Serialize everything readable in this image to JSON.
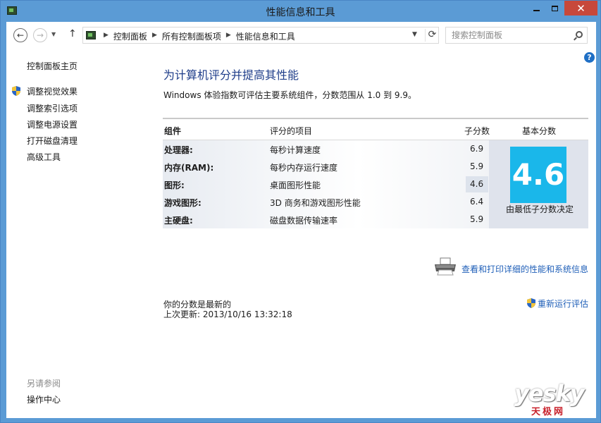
{
  "window": {
    "title": "性能信息和工具",
    "minimize_glyph": "—",
    "close_glyph": "✕"
  },
  "navbar": {
    "back_glyph": "←",
    "forward_glyph": "→",
    "up_glyph": "↑",
    "breadcrumbs": [
      "控制面板",
      "所有控制面板项",
      "性能信息和工具"
    ],
    "breadcrumb_separator": "▶",
    "search_placeholder": "搜索控制面板"
  },
  "sidebar": {
    "home": "控制面板主页",
    "links": [
      "调整视觉效果",
      "调整索引选项",
      "调整电源设置",
      "打开磁盘清理",
      "高级工具"
    ],
    "see_also_heading": "另请参阅",
    "see_also_links": [
      "操作中心"
    ]
  },
  "main": {
    "title": "为计算机评分并提高其性能",
    "subtitle": "Windows 体验指数可评估主要系统组件，分数范围从 1.0 到 9.9。",
    "table": {
      "headers": {
        "component": "组件",
        "item": "评分的项目",
        "subscore": "子分数",
        "basescore": "基本分数"
      },
      "rows": [
        {
          "component": "处理器:",
          "item": "每秒计算速度",
          "score": "6.9"
        },
        {
          "component": "内存(RAM):",
          "item": "每秒内存运行速度",
          "score": "5.9"
        },
        {
          "component": "图形:",
          "item": "桌面图形性能",
          "score": "4.6"
        },
        {
          "component": "游戏图形:",
          "item": "3D 商务和游戏图形性能",
          "score": "6.4"
        },
        {
          "component": "主硬盘:",
          "item": "磁盘数据传输速率",
          "score": "5.9"
        }
      ],
      "lowest_row_index": 2,
      "base_score": "4.6",
      "base_caption": "由最低子分数决定"
    },
    "print_link": "查看和打印详细的性能和系统信息",
    "status_line1": "你的分数是最新的",
    "status_line2": "上次更新: 2013/10/16 13:32:18",
    "rerun_link": "重新运行评估",
    "help_glyph": "?"
  },
  "watermark": {
    "main": "yesky",
    "sub": "天极网"
  },
  "colors": {
    "window_frame": "#5b9bd5",
    "score_tile": "#1ab7ea",
    "link": "#1f5fb8",
    "title": "#1e3d8a",
    "close_button": "#c7483b"
  }
}
